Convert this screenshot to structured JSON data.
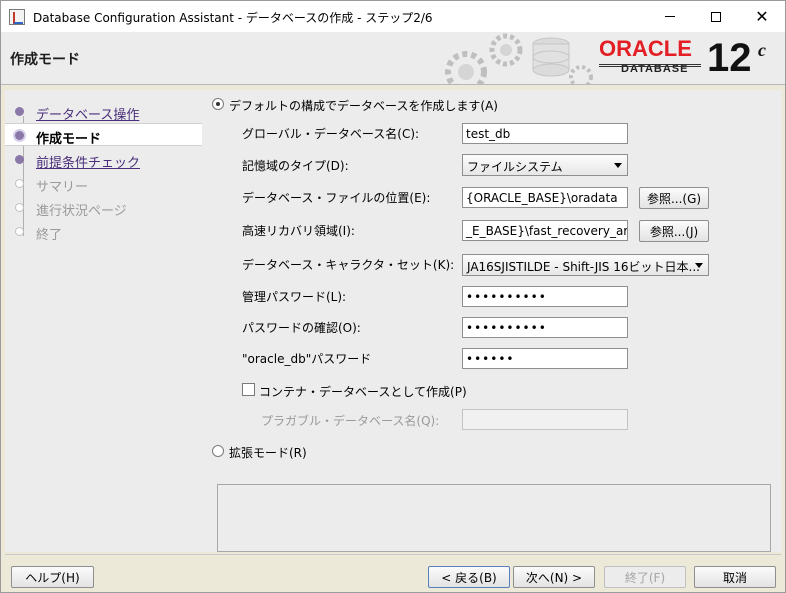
{
  "window": {
    "title": "Database Configuration Assistant - データベースの作成 - ステップ2/6"
  },
  "header": {
    "title": "作成モード",
    "brand_word": "ORACLE",
    "brand_sub": "DATABASE",
    "version": "12",
    "version_sup": "c"
  },
  "sidebar": {
    "items": [
      {
        "label": "データベース操作",
        "state": "link"
      },
      {
        "label": "作成モード",
        "state": "current"
      },
      {
        "label": "前提条件チェック",
        "state": "link"
      },
      {
        "label": "サマリー",
        "state": "disabled"
      },
      {
        "label": "進行状況ページ",
        "state": "disabled"
      },
      {
        "label": "終了",
        "state": "disabled"
      }
    ]
  },
  "form": {
    "default_mode_label": "デフォルトの構成でデータベースを作成します(A)",
    "global_db_name_label": "グローバル・データベース名(C):",
    "global_db_name_value": "test_db",
    "storage_type_label": "記憶域のタイプ(D):",
    "storage_type_value": "ファイルシステム",
    "db_file_location_label": "データベース・ファイルの位置(E):",
    "db_file_location_value": "{ORACLE_BASE}\\oradata",
    "browse_g_label": "参照...(G)",
    "fra_label": "高速リカバリ領域(I):",
    "fra_value": "_E_BASE}\\fast_recovery_area",
    "browse_j_label": "参照...(J)",
    "charset_label": "データベース・キャラクタ・セット(K):",
    "charset_value": "JA16SJISTILDE - Shift-JIS 16ビット日本...",
    "admin_password_label": "管理パスワード(L):",
    "admin_password_value": "••••••••••",
    "confirm_password_label": "パスワードの確認(O):",
    "confirm_password_value": "••••••••••",
    "oracle_db_password_label": "\"oracle_db\"パスワード",
    "oracle_db_password_value": "••••••",
    "container_db_label": "コンテナ・データベースとして作成(P)",
    "pluggable_db_label": "プラガブル・データベース名(Q):",
    "pluggable_db_value": "",
    "advanced_mode_label": "拡張モード(R)"
  },
  "footer": {
    "help_label": "ヘルプ(H)",
    "back_label": "< 戻る(B)",
    "next_label": "次へ(N) >",
    "finish_label": "終了(F)",
    "cancel_label": "取消"
  }
}
